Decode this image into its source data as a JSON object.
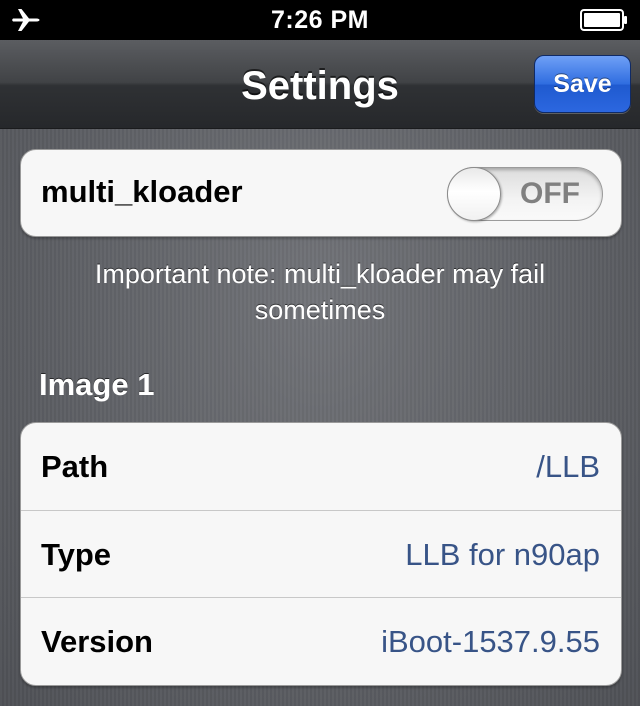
{
  "status_bar": {
    "time": "7:26 PM",
    "left_icon": "airplane-icon",
    "right_icon": "battery-icon"
  },
  "nav": {
    "title": "Settings",
    "save_label": "Save",
    "save_color": "#2f6de0"
  },
  "toggle": {
    "label": "multi_kloader",
    "state": "OFF"
  },
  "note": "Important note: multi_kloader may fail sometimes",
  "section": {
    "title": "Image 1",
    "rows": [
      {
        "label": "Path",
        "value": "/LLB"
      },
      {
        "label": "Type",
        "value": "LLB for n90ap"
      },
      {
        "label": "Version",
        "value": "iBoot-1537.9.55"
      }
    ]
  },
  "colors": {
    "value_text": "#385487"
  }
}
